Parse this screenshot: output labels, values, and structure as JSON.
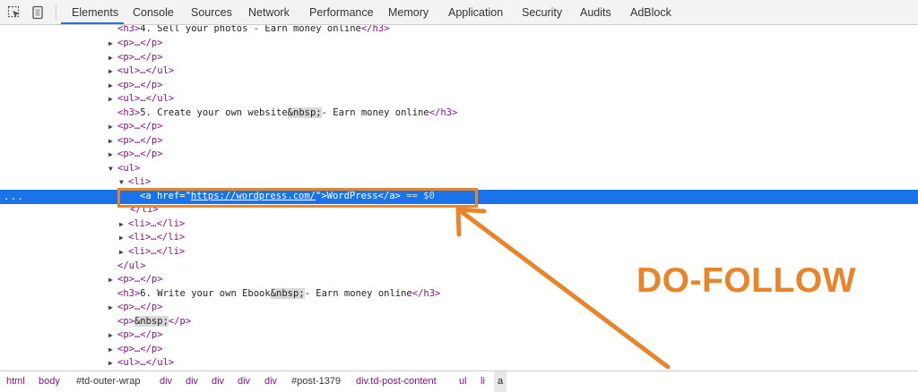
{
  "toolbar": {
    "icons": [
      "inspect-element-icon",
      "device-toolbar-icon"
    ],
    "tabs": [
      {
        "label": "Elements",
        "active": true
      },
      {
        "label": "Console"
      },
      {
        "label": "Sources"
      },
      {
        "label": "Network"
      },
      {
        "label": "Performance"
      },
      {
        "label": "Memory"
      },
      {
        "label": "Application"
      },
      {
        "label": "Security"
      },
      {
        "label": "Audits"
      },
      {
        "label": "AdBlock"
      }
    ]
  },
  "tree": {
    "rows": [
      {
        "open": "<h3>",
        "text": "4. Sell your photos - Earn money online",
        "close": "</h3>"
      },
      {
        "collapsed": "<p>…</p>"
      },
      {
        "collapsed": "<p>…</p>"
      },
      {
        "collapsed": "<ul>…</ul>"
      },
      {
        "collapsed": "<p>…</p>"
      },
      {
        "collapsed": "<ul>…</ul>"
      },
      {
        "open": "<h3>",
        "text": "5. Create your own website",
        "entity": "&nbsp;",
        "text2": "- Earn money online",
        "close": "</h3>"
      },
      {
        "collapsed": "<p>…</p>"
      },
      {
        "collapsed": "<p>…</p>"
      },
      {
        "collapsed": "<p>…</p>"
      },
      {
        "open": "<ul>"
      },
      {
        "open": "<li>"
      },
      {
        "selected_open": "<a href=\"",
        "href": "https://wordpress.com/",
        "selected_mid": "\">",
        "link_text": "WordPress",
        "selected_close": "</a>",
        "marker": "== $0"
      },
      {
        "close": "</li>"
      },
      {
        "collapsed": "<li>…</li>"
      },
      {
        "collapsed": "<li>…</li>"
      },
      {
        "collapsed": "<li>…</li>"
      },
      {
        "close": "</ul>"
      },
      {
        "collapsed": "<p>…</p>"
      },
      {
        "open": "<h3>",
        "text": "6. Write your own Ebook",
        "entity": "&nbsp;",
        "text2": "- Earn money online",
        "close": "</h3>"
      },
      {
        "collapsed": "<p>…</p>"
      },
      {
        "open": "<p>",
        "entity": "&nbsp;",
        "close": "</p>"
      },
      {
        "collapsed": "<p>…</p>"
      },
      {
        "collapsed": "<p>…</p>"
      },
      {
        "collapsed": "<ul>…</ul>"
      }
    ],
    "selected_dots": "..."
  },
  "annotation": {
    "label": "DO-FOLLOW",
    "color": "#e8842a"
  },
  "breadcrumb": [
    "html",
    "body",
    "#td-outer-wrap",
    "div",
    "div",
    "div",
    "div",
    "div",
    "#post-1379",
    "div.td-post-content",
    "ul",
    "li",
    "a"
  ],
  "colors": {
    "accent": "#1a73e8",
    "tag": "#881280",
    "annotation": "#e8842a"
  }
}
